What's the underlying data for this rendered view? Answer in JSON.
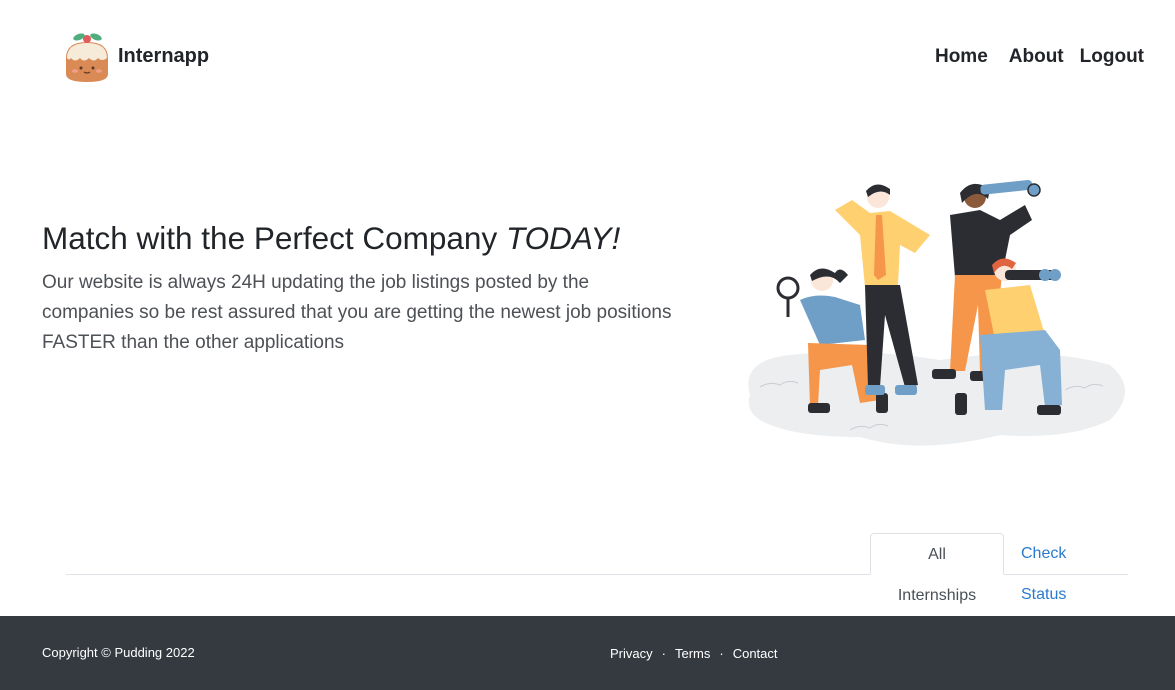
{
  "brand": {
    "name": "Internapp",
    "logo_icon": "pudding-logo-icon"
  },
  "nav": {
    "home": "Home",
    "about": "About",
    "logout": "Logout"
  },
  "hero": {
    "title_main": "Match with the Perfect Company ",
    "title_emphasis": "TODAY!",
    "description": "Our website is always 24H updating the job listings posted by the companies so be rest assured that you are getting the newest job positions FASTER than the other applications",
    "illustration_icon": "people-searching-illustration"
  },
  "tabs": {
    "all_internships": "All Internships",
    "check_status": "Check Status"
  },
  "footer": {
    "copyright": "Copyright © Pudding 2022",
    "links": [
      "Privacy",
      "Terms",
      "Contact"
    ],
    "separator": "·"
  },
  "colors": {
    "footer_bg": "#343a40",
    "link": "#2b7bcd",
    "text": "#212529"
  }
}
